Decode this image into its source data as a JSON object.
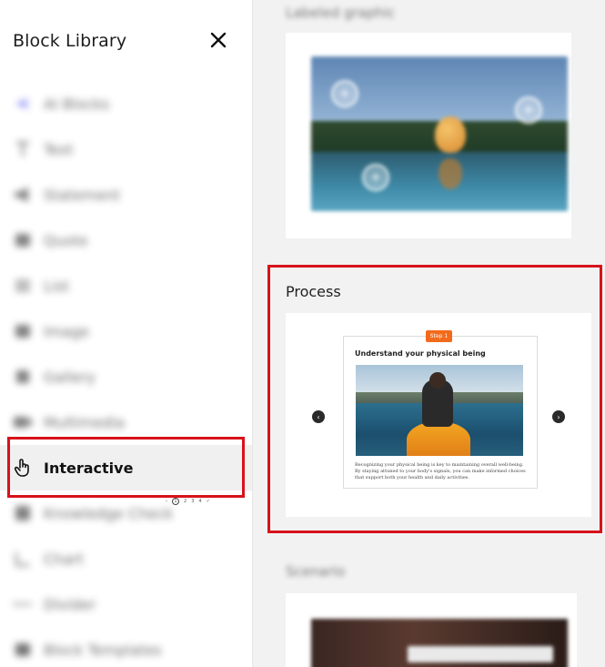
{
  "sidebar": {
    "title": "Block Library",
    "items": [
      {
        "label": "AI Blocks",
        "icon": "ai-sparkle-icon"
      },
      {
        "label": "Text",
        "icon": "text-icon"
      },
      {
        "label": "Statement",
        "icon": "megaphone-icon"
      },
      {
        "label": "Quote",
        "icon": "quote-icon"
      },
      {
        "label": "List",
        "icon": "list-icon"
      },
      {
        "label": "Image",
        "icon": "image-icon"
      },
      {
        "label": "Gallery",
        "icon": "gallery-icon"
      },
      {
        "label": "Multimedia",
        "icon": "multimedia-icon"
      },
      {
        "label": "Interactive",
        "icon": "pointer-hand-icon"
      },
      {
        "label": "Knowledge Check",
        "icon": "knowledge-check-icon"
      },
      {
        "label": "Chart",
        "icon": "chart-icon"
      },
      {
        "label": "Divider",
        "icon": "divider-icon"
      },
      {
        "label": "Block Templates",
        "icon": "templates-icon"
      }
    ],
    "active_item": "Interactive"
  },
  "panel": {
    "sections": [
      {
        "label": "Labeled graphic"
      },
      {
        "label": "Process"
      },
      {
        "label": "Scenario"
      }
    ],
    "process_preview": {
      "step_badge": "Step 1",
      "title": "Understand your physical being",
      "body": "Recognizing your physical being is key to maintaining overall well-being. By staying attuned to your body's signals, you can make informed choices that support both your health and daily activities.",
      "pager": {
        "prev": "‹",
        "current": "1",
        "pages": [
          "2",
          "3",
          "4"
        ],
        "done": "✓"
      }
    },
    "hotspot_glyph": "+"
  },
  "colors": {
    "highlight": "#d7121a",
    "step_badge": "#f26a1b"
  }
}
